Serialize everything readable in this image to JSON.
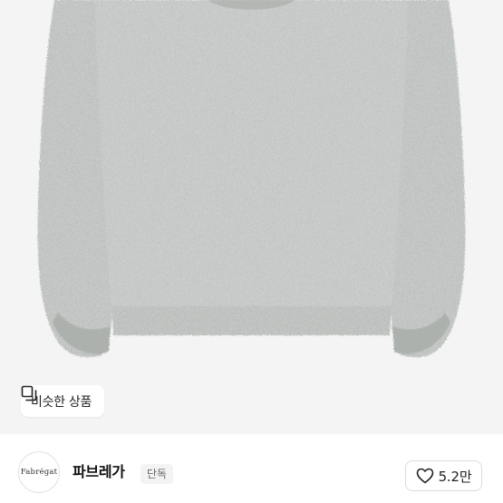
{
  "product": {
    "image_subject": "gray fuzzy knit sweater",
    "similar_button": {
      "label": "비슷한 상품",
      "icon": "similar-items-icon"
    }
  },
  "store": {
    "logo_text": "Fabrégat",
    "name": "파브레가",
    "badge": "단독",
    "like": {
      "icon": "heart-outline-icon",
      "count": "5.2만"
    }
  },
  "colors": {
    "background": "#f4f4f4",
    "sweater": "#b7bbb8",
    "text": "#111111",
    "badge_bg": "#f3f3f3"
  }
}
